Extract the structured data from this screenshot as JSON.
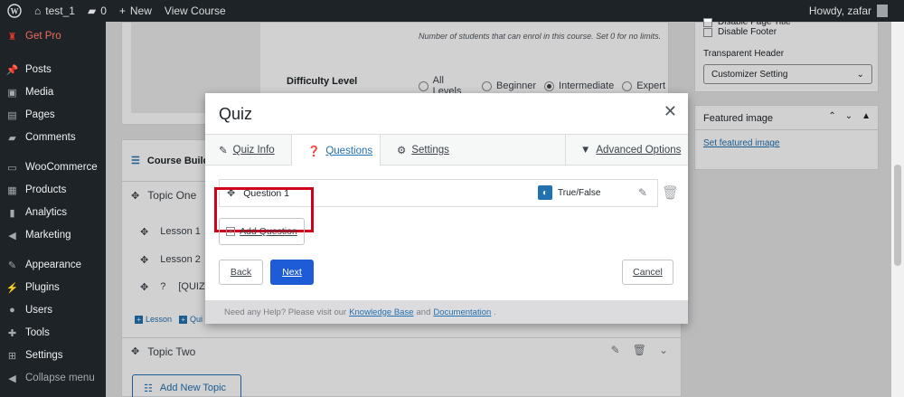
{
  "adminbar": {
    "site_name": "test_1",
    "comments_count": "0",
    "new_label": "New",
    "view_course_label": "View Course",
    "howdy": "Howdy, zafar"
  },
  "sidebar": {
    "items": [
      {
        "label": "Get Pro",
        "icon": "get-pro-icon"
      },
      {
        "label": "Posts",
        "icon": "posts-icon"
      },
      {
        "label": "Media",
        "icon": "media-icon"
      },
      {
        "label": "Pages",
        "icon": "pages-icon"
      },
      {
        "label": "Comments",
        "icon": "comments-icon"
      },
      {
        "label": "WooCommerce",
        "icon": "woocommerce-icon"
      },
      {
        "label": "Products",
        "icon": "products-icon"
      },
      {
        "label": "Analytics",
        "icon": "analytics-icon"
      },
      {
        "label": "Marketing",
        "icon": "marketing-icon"
      },
      {
        "label": "Appearance",
        "icon": "appearance-icon"
      },
      {
        "label": "Plugins",
        "icon": "plugins-icon"
      },
      {
        "label": "Users",
        "icon": "users-icon"
      },
      {
        "label": "Tools",
        "icon": "tools-icon"
      },
      {
        "label": "Settings",
        "icon": "settings-icon"
      },
      {
        "label": "Collapse menu",
        "icon": "collapse-icon"
      }
    ]
  },
  "course": {
    "enrol_note": "Number of students that can enrol in this course. Set 0 for no limits.",
    "difficulty_label": "Difficulty Level",
    "difficulty_options": [
      "All Levels",
      "Beginner",
      "Intermediate",
      "Expert"
    ],
    "difficulty_selected": "Intermediate",
    "builder_title": "Course Builde",
    "topic_one": "Topic One",
    "lessons": [
      "Lesson 1",
      "Lesson 2",
      "[QUIZ"
    ],
    "add_lesson": "Lesson",
    "add_quiz": "Qui",
    "topic_two": "Topic Two",
    "add_topic": "Add New Topic"
  },
  "right_panel": {
    "partial_checkbox": "Disable Page Title",
    "disable_footer": "Disable Footer",
    "transparent_header_label": "Transparent Header",
    "transparent_header_value": "Customizer Setting",
    "featured_image_title": "Featured image",
    "set_featured_image": "Set featured image"
  },
  "modal": {
    "title": "Quiz",
    "tabs": {
      "quiz_info": "Quiz Info",
      "questions": "Questions",
      "settings": "Settings",
      "advanced": "Advanced Options"
    },
    "question": {
      "title": "Question 1",
      "type": "True/False"
    },
    "add_question": "Add Question",
    "back": "Back",
    "next": "Next",
    "cancel": "Cancel",
    "footer": {
      "text1": "Need any Help? Please visit our",
      "link1": "Knowledge Base",
      "text2": "and",
      "link2": "Documentation",
      "end": "."
    }
  },
  "colors": {
    "accent": "#2271b1",
    "highlight": "#d0021b",
    "adminbar": "#1d2327"
  }
}
